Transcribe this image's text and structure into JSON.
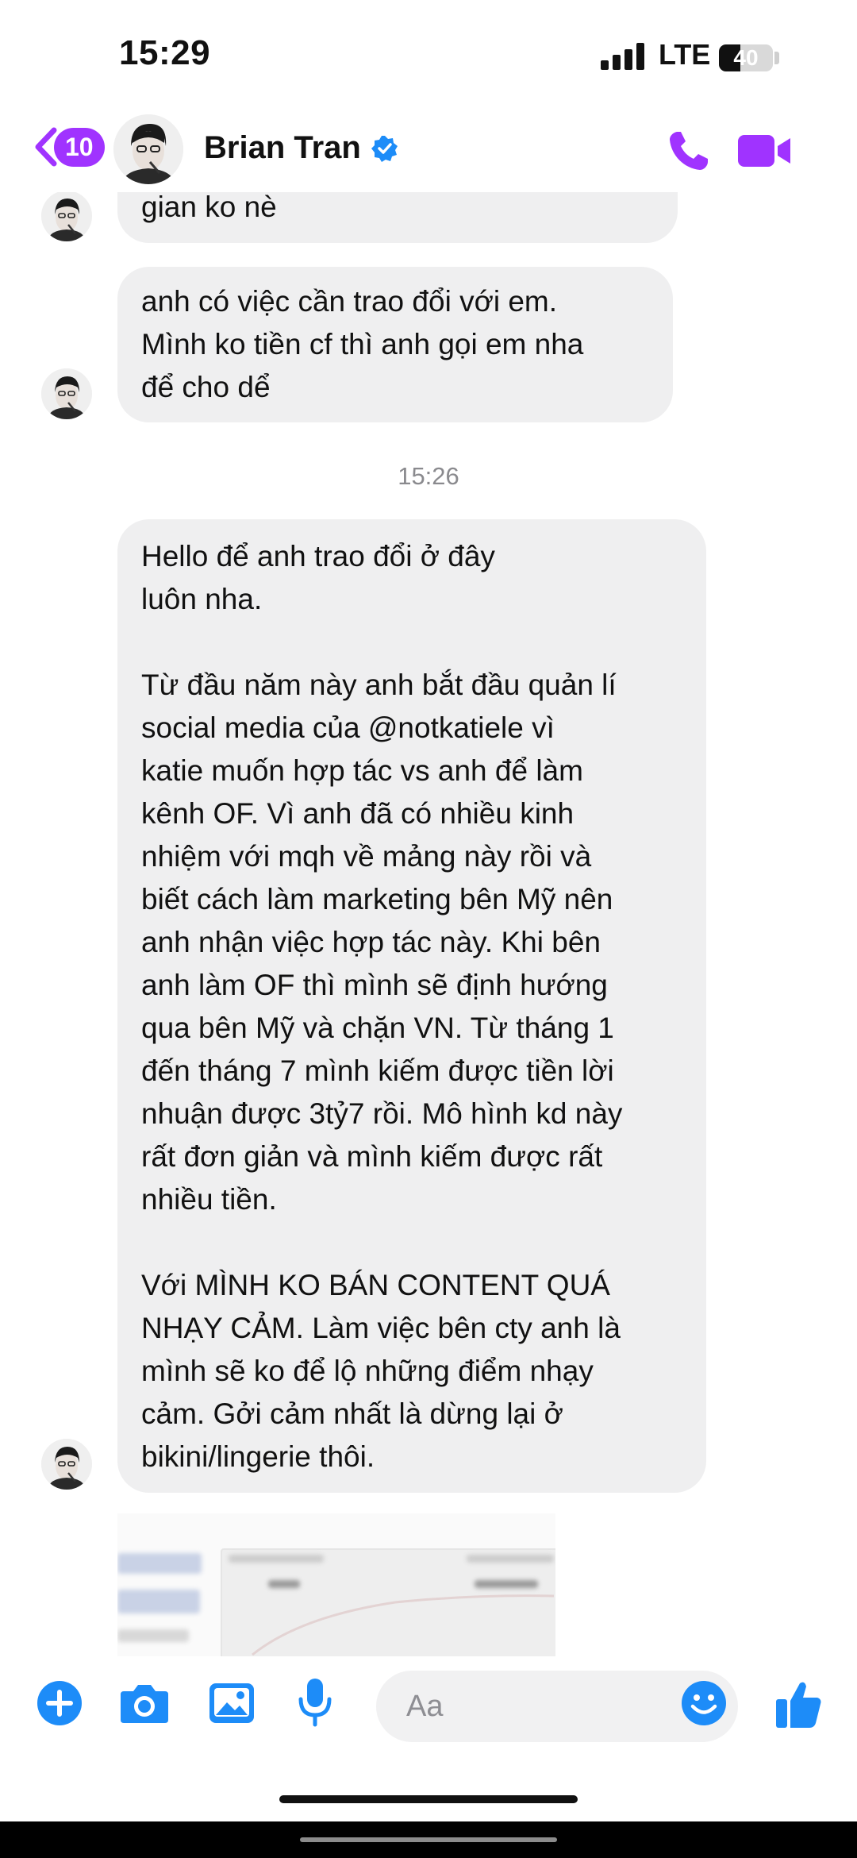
{
  "status_bar": {
    "time": "15:29",
    "network": "LTE",
    "battery": "40",
    "battery_level": 0.4
  },
  "header": {
    "unread_count": "10",
    "contact_name": "Brian Tran"
  },
  "messages": {
    "m1": [
      "gian ko nè"
    ],
    "m2": [
      "anh có việc cần trao đổi với em.",
      "Mình ko tiền cf thì anh gọi em nha",
      "để cho dể"
    ],
    "timestamp": "15:26",
    "m3": [
      "Hello để anh trao đổi ở đây",
      "luôn nha.",
      "",
      "Từ đầu năm này anh bắt đầu quản lí",
      "social media của @notkatiele vì",
      "katie muốn hợp tác vs anh để làm",
      "kênh OF. Vì anh đã có nhiều kinh",
      "nhiệm với mqh về mảng này rồi và",
      "biết cách làm marketing bên Mỹ nên",
      "anh nhận việc hợp tác này. Khi bên",
      "anh làm OF thì mình sẽ định hướng",
      "qua bên Mỹ và chặn VN. Từ tháng 1",
      "đến tháng 7 mình kiếm được tiền lời",
      "nhuận được 3tỷ7 rồi. Mô hình kd này",
      "rất đơn giản và mình kiếm được rất",
      "nhiều tiền.",
      "",
      "Với MÌNH KO BÁN CONTENT QUÁ",
      "NHẠY CẢM. Làm việc bên cty anh là",
      "mình sẽ ko để lộ những điểm nhạy",
      "cảm. Gởi cảm nhất là dừng lại ở",
      "bikini/lingerie thôi."
    ]
  },
  "composer": {
    "placeholder": "Aa"
  },
  "colors": {
    "accent": "#a033ff",
    "bubble": "#efeff0",
    "verified": "#1d8cf8"
  },
  "icons": [
    "back-chevron-icon",
    "phone-icon",
    "video-camera-icon",
    "plus-icon",
    "camera-icon",
    "image-icon",
    "microphone-icon",
    "emoji-icon",
    "thumbs-up-icon"
  ]
}
